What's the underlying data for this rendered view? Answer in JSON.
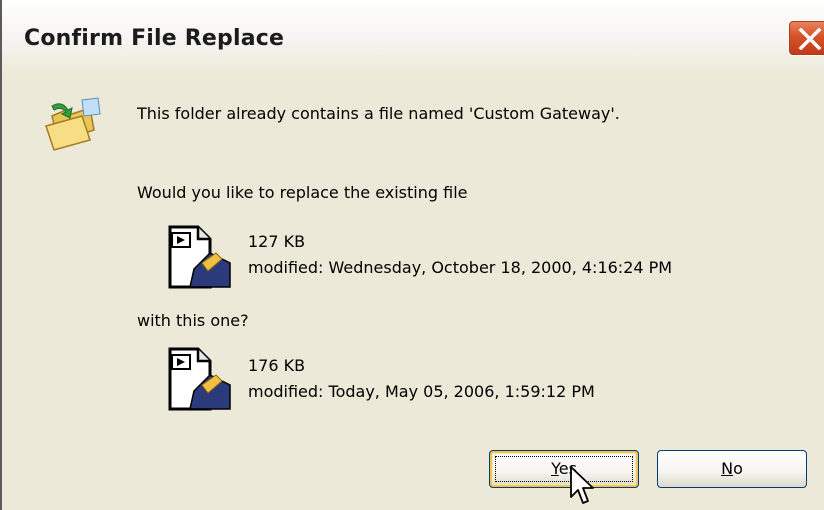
{
  "window": {
    "title": "Confirm File Replace"
  },
  "message": {
    "line1": "This folder already contains a file named 'Custom Gateway'.",
    "line2": "Would you like to replace the existing file",
    "with_text": "with this one?"
  },
  "existing_file": {
    "size": "127 KB",
    "modified": "modified: Wednesday, October 18, 2000, 4:16:24 PM"
  },
  "new_file": {
    "size": "176 KB",
    "modified": "modified: Today, May 05, 2006, 1:59:12 PM"
  },
  "buttons": {
    "yes_prefix": "",
    "yes_accel": "Y",
    "yes_rest": "es",
    "no_prefix": "",
    "no_accel": "N",
    "no_rest": "o"
  },
  "icons": {
    "close": "close-icon",
    "folder": "folder-move-icon",
    "file": "media-file-icon",
    "cursor": "pointer-cursor-icon"
  }
}
